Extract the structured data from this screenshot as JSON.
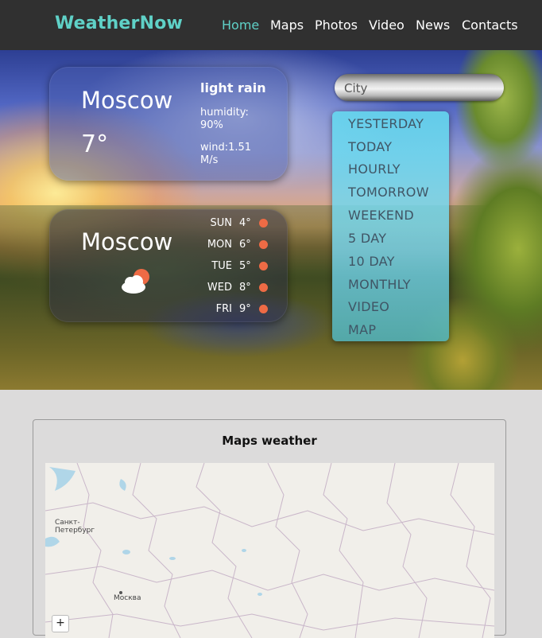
{
  "header": {
    "logo": "WeatherNow",
    "nav": [
      {
        "label": "Home",
        "active": true
      },
      {
        "label": "Maps",
        "active": false
      },
      {
        "label": "Photos",
        "active": false
      },
      {
        "label": "Video",
        "active": false
      },
      {
        "label": "News",
        "active": false
      },
      {
        "label": "Contacts",
        "active": false
      }
    ]
  },
  "current": {
    "city": "Moscow",
    "temp": "7°",
    "condition": "light rain",
    "humidity": "humidity: 90%",
    "wind": "wind:1.51 M/s"
  },
  "forecast": {
    "city": "Moscow",
    "icon": "cloud-sun-icon",
    "days": [
      {
        "day": "SUN",
        "temp": "4°"
      },
      {
        "day": "MON",
        "temp": "6°"
      },
      {
        "day": "TUE",
        "temp": "5°"
      },
      {
        "day": "WED",
        "temp": "8°"
      },
      {
        "day": "FRI",
        "temp": "9°"
      }
    ]
  },
  "search": {
    "placeholder": "City"
  },
  "menu": [
    "YESTERDAY",
    "TODAY",
    "HOURLY",
    "TOMORROW",
    "WEEKEND",
    "5 DAY",
    "10 DAY",
    "MONTHLY",
    "VIDEO",
    "MAP"
  ],
  "map_section": {
    "title": "Maps weather",
    "labels": {
      "spb": "Санкт-\nПетербург",
      "moscow": "Москва"
    },
    "zoom_in": "+"
  },
  "colors": {
    "accent": "#5fd1c7",
    "header_bg": "#303030",
    "dot": "#ee6b45",
    "menu_bg": "#7fd8ea"
  }
}
